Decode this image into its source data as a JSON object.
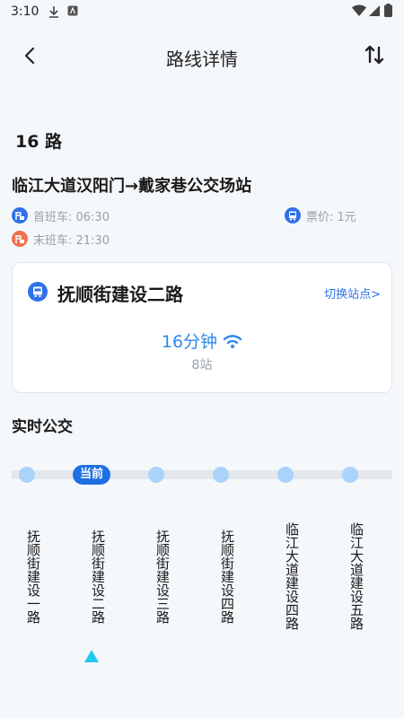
{
  "status_bar": {
    "time": "3:10"
  },
  "header": {
    "title": "路线详情"
  },
  "route": {
    "number": "16 路",
    "direction": "临江大道汉阳门→戴家巷公交场站",
    "first_bus": "首班车: 06:30",
    "last_bus": "末班车: 21:30",
    "fare": "票价: 1元"
  },
  "card": {
    "stop_name": "抚顺街建设二路",
    "switch_label": "切换站点>",
    "eta": "16分钟",
    "stations": "8站"
  },
  "realtime": {
    "title": "实时公交",
    "current_label": "当前",
    "stops": [
      {
        "name": "抚顺街建设一路"
      },
      {
        "name": "抚顺街建设二路"
      },
      {
        "name": "抚顺街建设三路"
      },
      {
        "name": "抚顺街建设四路"
      },
      {
        "name": "临江大道建设四路"
      },
      {
        "name": "临江大道建设五路"
      }
    ]
  },
  "colors": {
    "accent": "#2f71e8",
    "first_bus": "#2f71e8",
    "last_bus": "#f0714f"
  }
}
